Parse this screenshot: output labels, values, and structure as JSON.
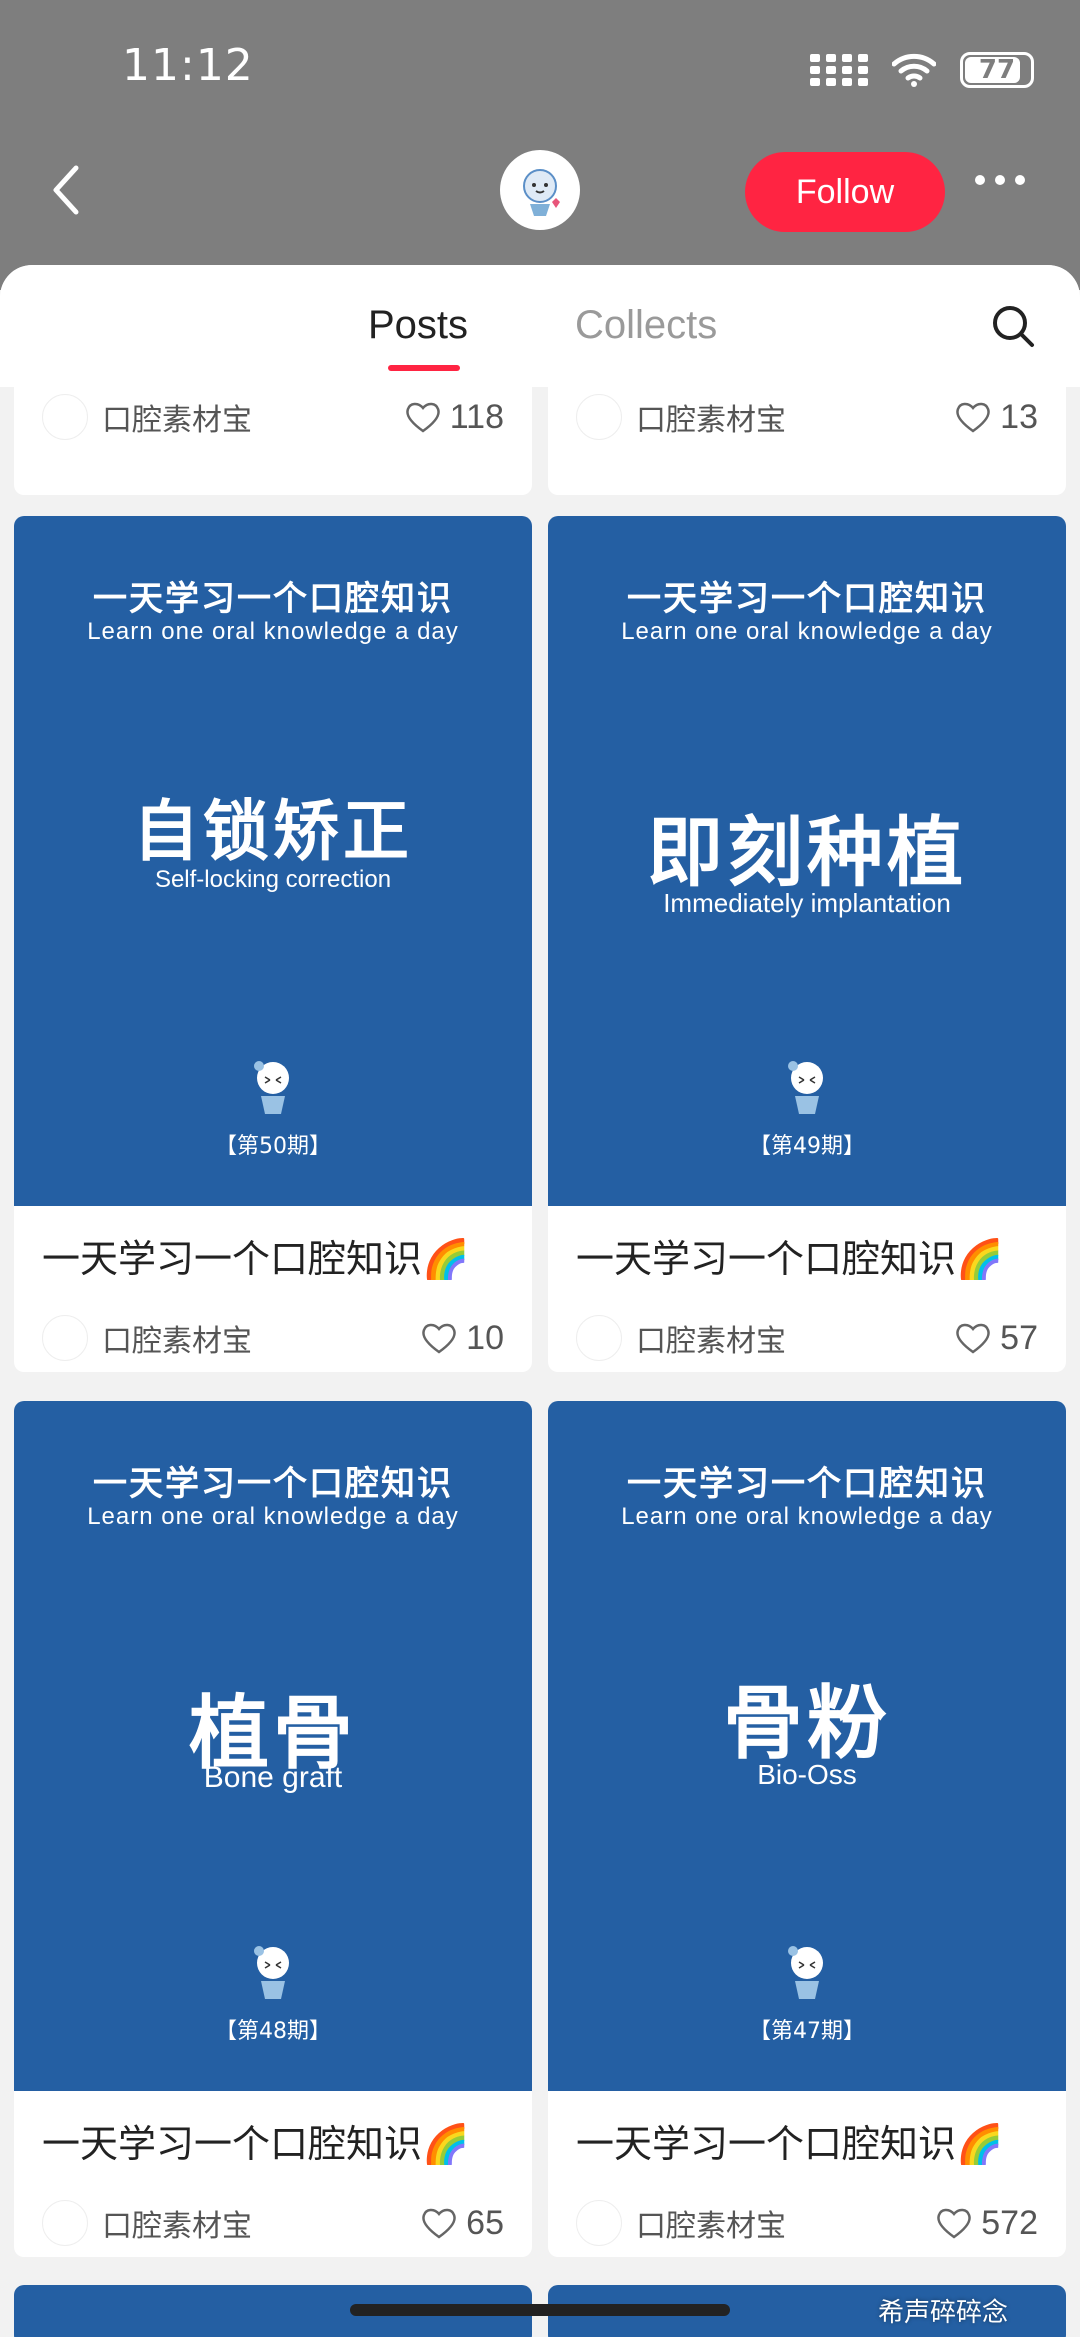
{
  "status": {
    "time": "11:12",
    "battery": "77"
  },
  "header": {
    "follow_label": "Follow"
  },
  "tabs": {
    "posts": "Posts",
    "collects": "Collects"
  },
  "partial_row": [
    {
      "author": "口腔素材宝",
      "likes": "118"
    },
    {
      "author": "口腔素材宝",
      "likes": "13"
    }
  ],
  "cards": [
    {
      "cn_top": "一天学习一个口腔知识",
      "en_top": "Learn one oral knowledge a day",
      "cn_title": "自锁矫正",
      "en_title": "Self-locking correction",
      "issue": "【第50期】",
      "title": "一天学习一个口腔知识🌈",
      "author": "口腔素材宝",
      "likes": "10"
    },
    {
      "cn_top": "一天学习一个口腔知识",
      "en_top": "Learn one oral knowledge a day",
      "cn_title": "即刻种植",
      "en_title": "Immediately implantation",
      "issue": "【第49期】",
      "title": "一天学习一个口腔知识🌈",
      "author": "口腔素材宝",
      "likes": "57"
    },
    {
      "cn_top": "一天学习一个口腔知识",
      "en_top": "Learn one oral knowledge a day",
      "cn_title": "植骨",
      "en_title": "Bone graft",
      "issue": "【第48期】",
      "title": "一天学习一个口腔知识🌈",
      "author": "口腔素材宝",
      "likes": "65"
    },
    {
      "cn_top": "一天学习一个口腔知识",
      "en_top": "Learn one oral knowledge a day",
      "cn_title": "骨粉",
      "en_title": "Bio-Oss",
      "issue": "【第47期】",
      "title": "一天学习一个口腔知识🌈",
      "author": "口腔素材宝",
      "likes": "572"
    }
  ],
  "watermark": "希声碎碎念",
  "colors": {
    "accent": "#ff2442",
    "cover_blue": "#245fa3"
  }
}
